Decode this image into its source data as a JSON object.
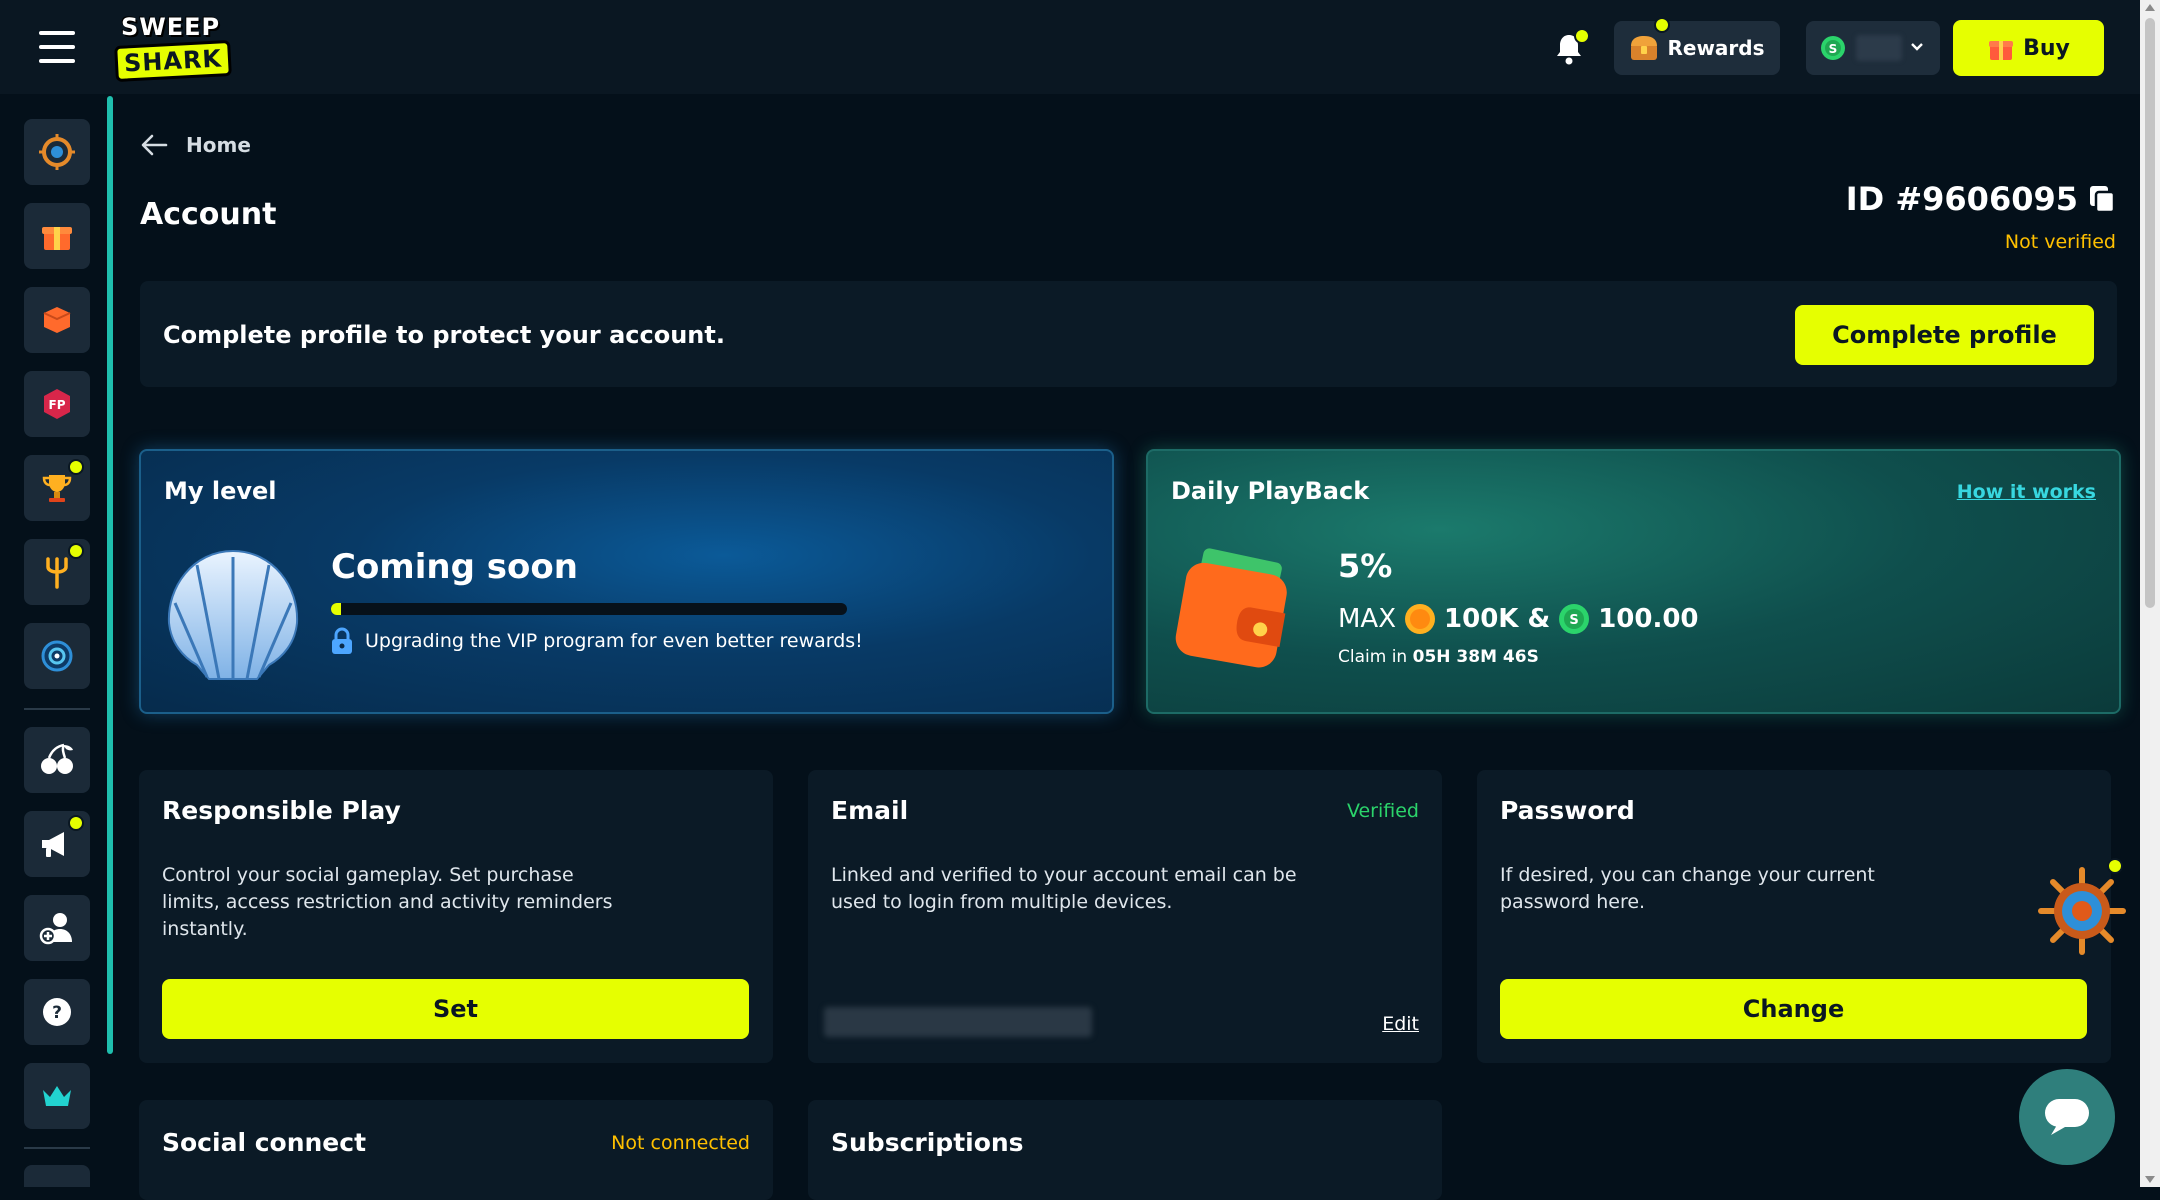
{
  "header": {
    "logo_line1": "SWEEP",
    "logo_line2": "SHARK",
    "rewards_label": "Rewards",
    "buy_label": "Buy"
  },
  "sidebar": {
    "items": [
      {
        "icon": "helm-wheel-icon"
      },
      {
        "icon": "gift-icon"
      },
      {
        "icon": "orange-box-icon"
      },
      {
        "icon": "fp-badge-icon"
      },
      {
        "icon": "trophy-icon"
      },
      {
        "icon": "trident-icon"
      },
      {
        "icon": "target-icon"
      },
      {
        "icon": "cherries-icon"
      },
      {
        "icon": "megaphone-icon"
      },
      {
        "icon": "add-user-icon"
      },
      {
        "icon": "help-icon"
      },
      {
        "icon": "crown-icon"
      }
    ]
  },
  "breadcrumb": {
    "label": "Home"
  },
  "page": {
    "title": "Account",
    "id_label": "ID #9606095",
    "verification": "Not verified"
  },
  "banner": {
    "text": "Complete profile to protect your account.",
    "button": "Complete profile"
  },
  "level_card": {
    "title": "My level",
    "status": "Coming soon",
    "progress_fraction": 0.02,
    "note": "Upgrading the VIP program for even better rewards!"
  },
  "playback_card": {
    "title": "Daily PlayBack",
    "link": "How it works",
    "percent": "5%",
    "max_label": "MAX",
    "gold_amount": "100K &",
    "sweep_amount": "100.00",
    "claim_prefix": "Claim in",
    "claim_time": "05H 38M 46S"
  },
  "responsible_play": {
    "title": "Responsible Play",
    "description": "Control your social gameplay. Set purchase limits, access restriction and activity reminders instantly.",
    "button": "Set"
  },
  "email": {
    "title": "Email",
    "status": "Verified",
    "description": "Linked and verified to your account email can be used to login from multiple devices.",
    "edit": "Edit"
  },
  "password": {
    "title": "Password",
    "description": "If desired, you can change your current password here.",
    "button": "Change"
  },
  "social_connect": {
    "title": "Social connect",
    "status": "Not connected"
  },
  "subscriptions": {
    "title": "Subscriptions"
  },
  "colors": {
    "accent": "#e6ff00",
    "warning": "#ffc000",
    "success": "#2bd46b",
    "link": "#38d7e0"
  }
}
